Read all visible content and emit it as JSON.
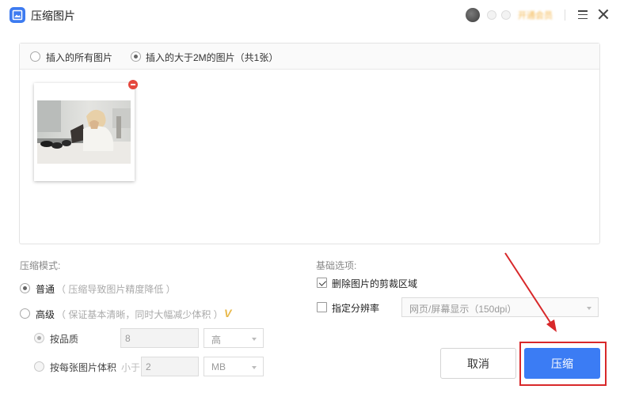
{
  "window": {
    "title": "压缩图片",
    "user_vip_text": "开通会员"
  },
  "image_filter": {
    "options": [
      "插入的所有图片",
      "插入的大于2M的图片（共1张）"
    ],
    "selected_index": 1
  },
  "images": [
    {
      "description": "office-photo"
    }
  ],
  "compress_mode": {
    "title": "压缩模式:",
    "normal": {
      "label": "普通",
      "hint": "（ 压缩导致图片精度降低 ）",
      "selected": true
    },
    "advanced": {
      "label": "高级",
      "hint": "（ 保证基本清晰，同时大幅减少体积 ）",
      "vip_badge": "V",
      "by_quality": {
        "label": "按品质",
        "value": "8",
        "level": "高"
      },
      "by_size": {
        "label": "按每张图片体积",
        "prefix": "小于",
        "value": "2",
        "unit": "MB"
      }
    }
  },
  "basic_options": {
    "title": "基础选项:",
    "delete_cropped": {
      "label": "删除图片的剪裁区域",
      "checked": true
    },
    "resolution": {
      "label": "指定分辨率",
      "checked": false,
      "value": "网页/屏幕显示（150dpi）"
    }
  },
  "buttons": {
    "cancel": "取消",
    "compress": "压缩"
  },
  "colors": {
    "accent": "#3b7cf4",
    "highlight": "#d8282a",
    "vip": "#e8b84a"
  }
}
